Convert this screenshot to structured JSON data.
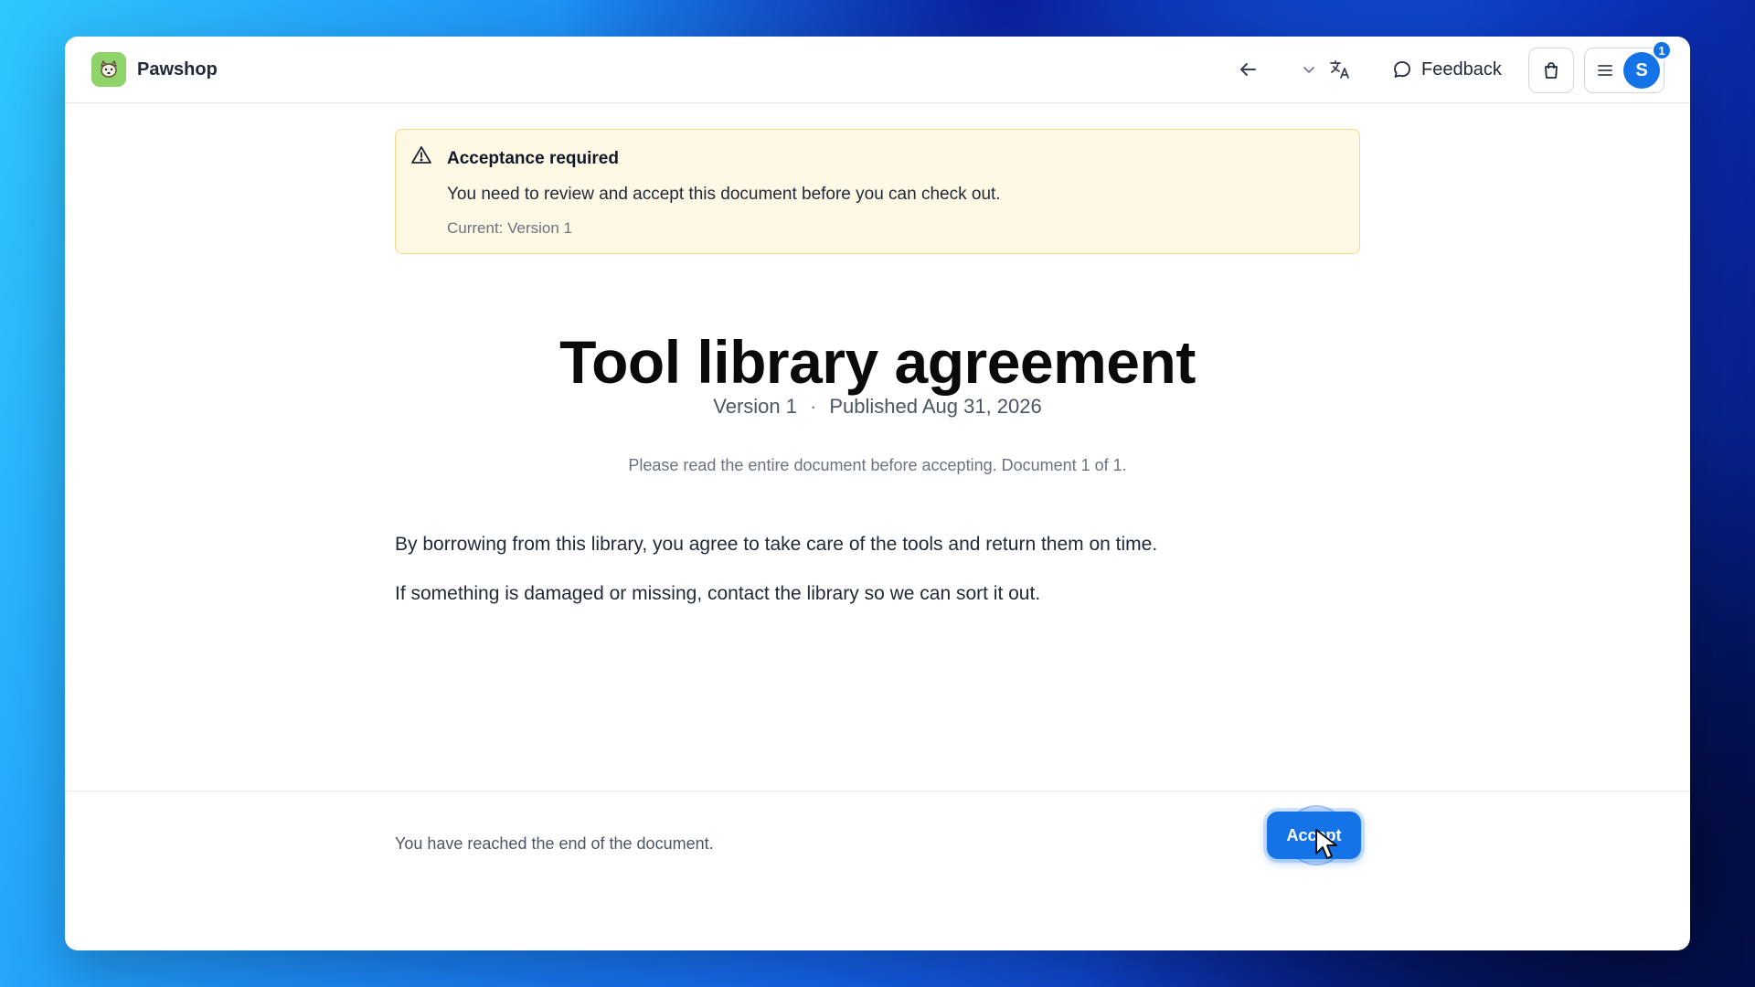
{
  "app": {
    "name": "Pawshop",
    "logo_icon": "dog-face-icon"
  },
  "header": {
    "back_icon": "arrow-left-icon",
    "language_icon": "translate-icon",
    "feedback_label": "Feedback",
    "cart_icon": "shopping-bag-icon",
    "menu_icon": "hamburger-menu-icon",
    "avatar_initial": "S",
    "notification_count": "1"
  },
  "alert": {
    "title": "Acceptance required",
    "message": "You need to review and accept this document before you can check out.",
    "current_version": "Current: Version 1",
    "icon": "warning-triangle-icon"
  },
  "document": {
    "title": "Tool library agreement",
    "version": "Version 1",
    "separator": "·",
    "published": "Published Aug 31, 2026",
    "note": "Please read the entire document before accepting. Document 1 of 1.",
    "paragraphs": [
      "By borrowing from this library, you agree to take care of the tools and return them on time.",
      "If something is damaged or missing, contact the library so we can sort it out."
    ]
  },
  "footer": {
    "end_message": "You have reached the end of the document.",
    "accept_label": "Accept"
  },
  "colors": {
    "accent": "#1473e6",
    "alert_bg": "#fef8e5",
    "alert_border": "#f3d688",
    "logo_bg": "#8fd36b"
  }
}
